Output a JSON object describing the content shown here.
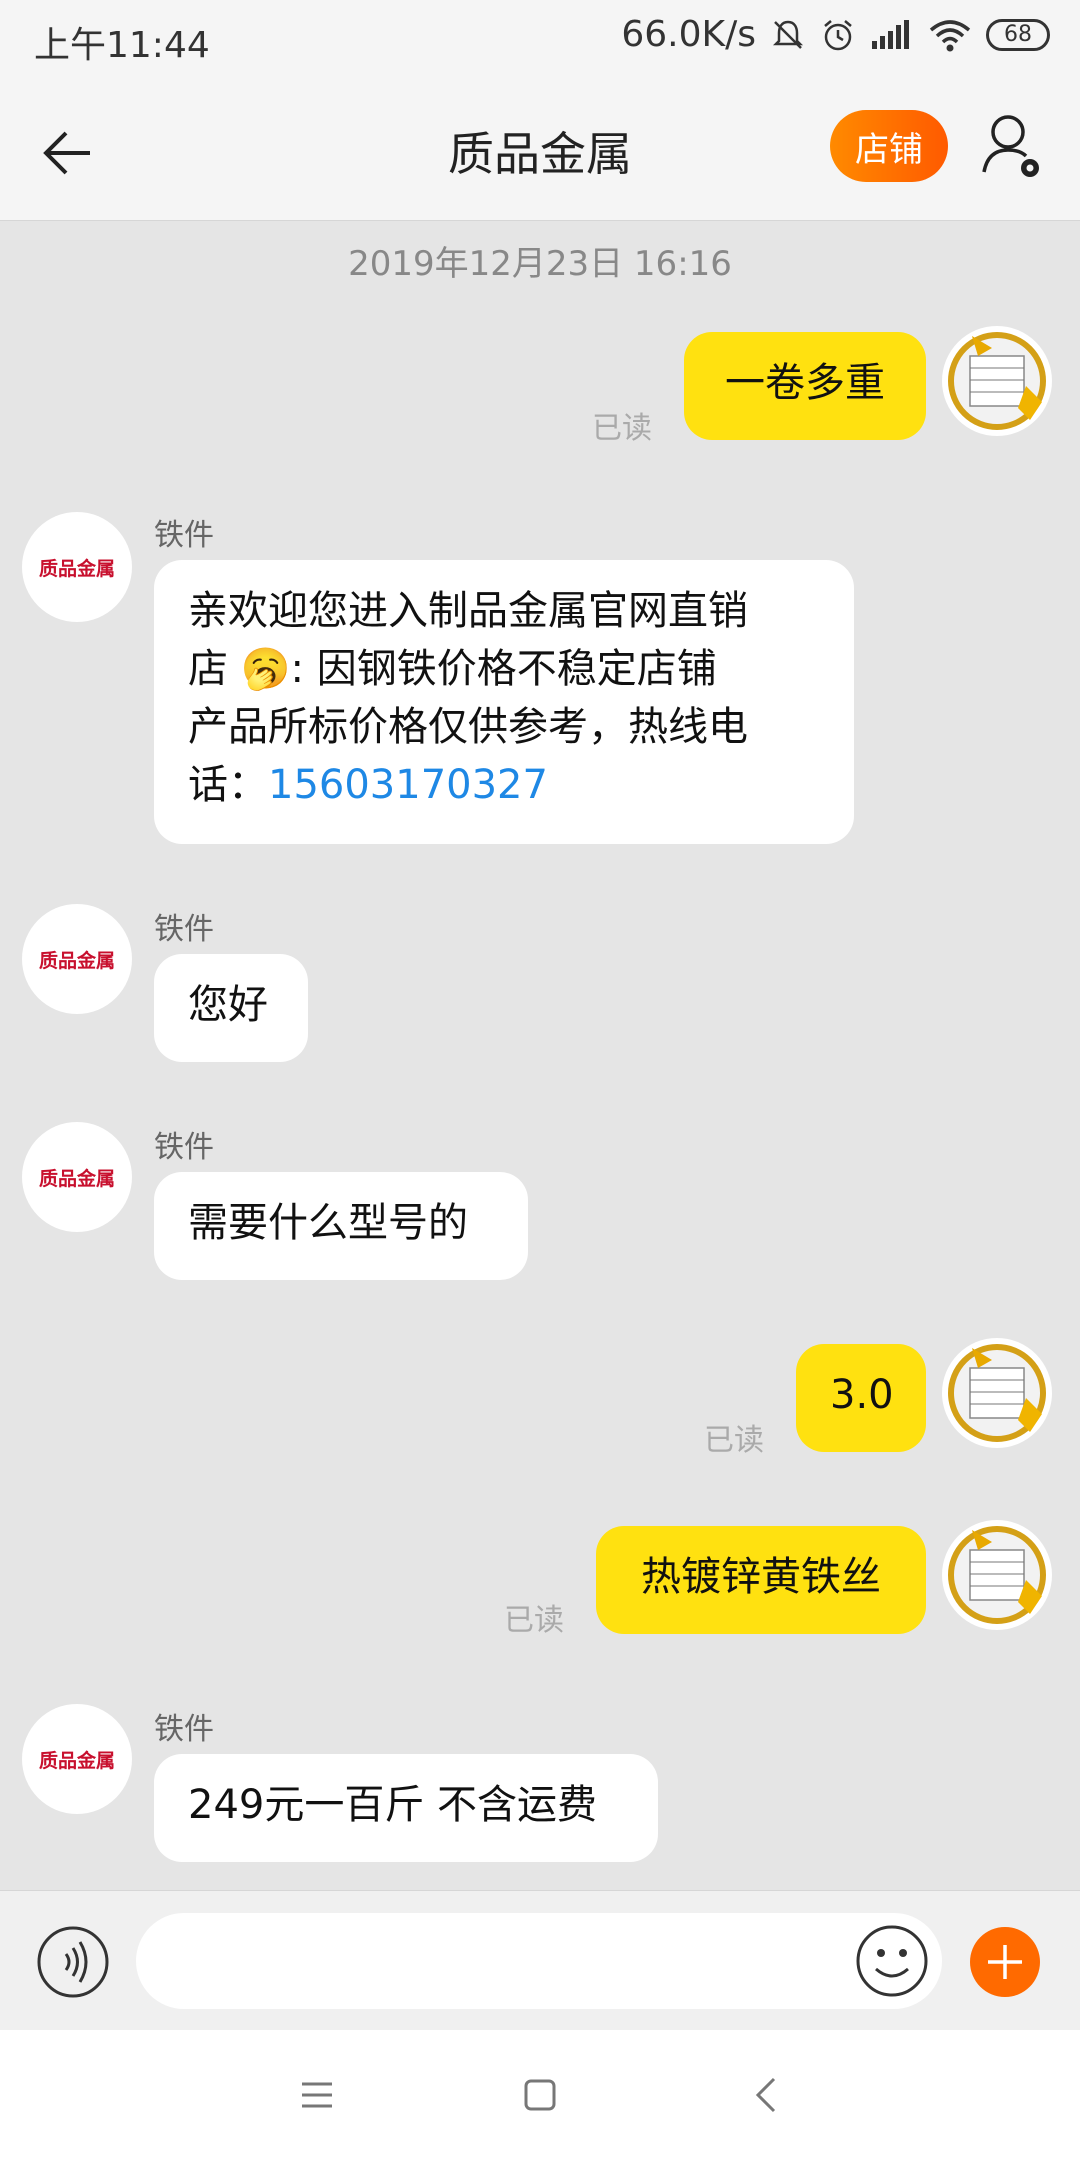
{
  "status_bar": {
    "time": "上午11:44",
    "network_speed": "66.0K/s",
    "battery": "68"
  },
  "header": {
    "title": "质品金属",
    "store_button": "店铺"
  },
  "chat": {
    "timestamp": "2019年12月23日 16:16",
    "store_avatar_text": "质品金属",
    "messages": [
      {
        "direction": "out",
        "text": "一卷多重",
        "status": "已读"
      },
      {
        "direction": "in",
        "sender": "铁件",
        "text_lines": [
          "亲欢迎您进入制品金属官网直销",
          "店 🥱: 因钢铁价格不稳定店铺",
          "产品所标价格仅供参考，热线电"
        ],
        "last_line_prefix": "话：",
        "phone": "15603170327"
      },
      {
        "direction": "in",
        "sender": "铁件",
        "text": "您好"
      },
      {
        "direction": "in",
        "sender": "铁件",
        "text": "需要什么型号的"
      },
      {
        "direction": "out",
        "text": "3.0",
        "status": "已读"
      },
      {
        "direction": "out",
        "text": "热镀锌黄铁丝",
        "status": "已读"
      },
      {
        "direction": "in",
        "sender": "铁件",
        "text": "249元一百斤 不含运费"
      }
    ]
  },
  "input": {
    "placeholder": ""
  },
  "colors": {
    "accent": "#ff6a00",
    "outgoing_bubble": "#ffe110",
    "incoming_bubble": "#ffffff",
    "link": "#1e88e5",
    "store_avatar_text": "#c8102e"
  },
  "icons": [
    "back-arrow-icon",
    "profile-settings-icon",
    "voice-icon",
    "emoji-icon",
    "plus-icon",
    "menu-icon",
    "home-icon",
    "back-icon"
  ]
}
